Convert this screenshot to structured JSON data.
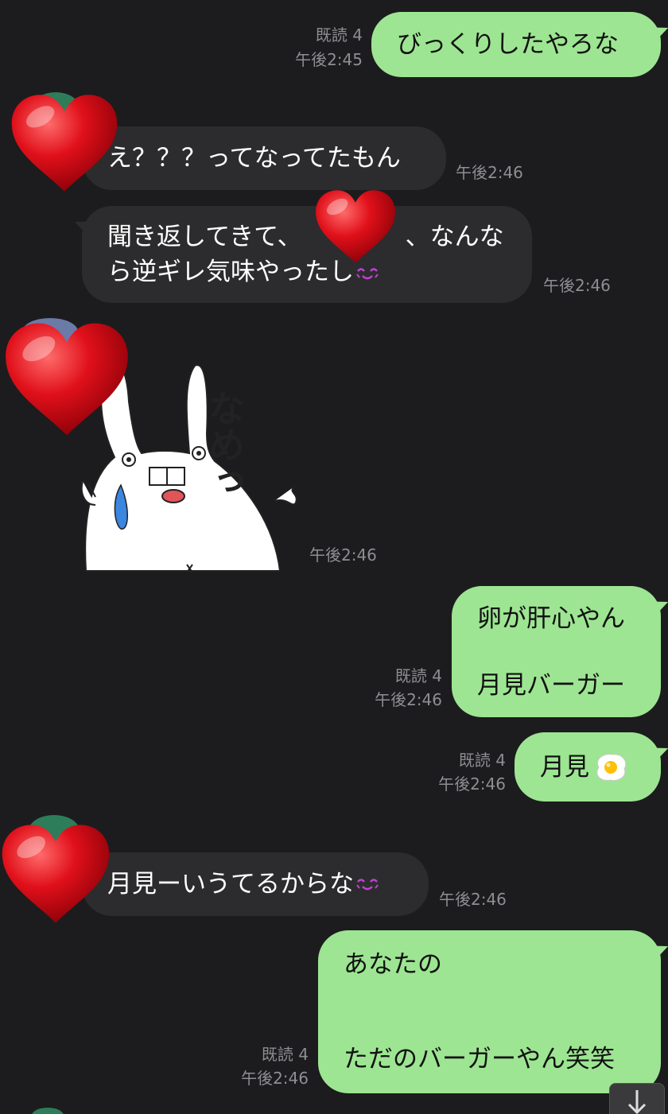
{
  "messages": [
    {
      "text": "びっくりしたやろな",
      "read": "既読 4",
      "time": "午後2:45"
    },
    {
      "text": "え？？？ってなってたもん",
      "time": "午後2:46"
    },
    {
      "line1": "聞き返してきて、",
      "line1b": "、なんな",
      "line2": "ら逆ギレ気味やったし",
      "time": "午後2:46"
    },
    {
      "sticker_text": "なめっ",
      "time": "午後2:46"
    },
    {
      "line1": "卵が肝心やん",
      "line2": "月見バーガー",
      "read": "既読 4",
      "time": "午後2:46"
    },
    {
      "text": "月見",
      "read": "既読 4",
      "time": "午後2:46"
    },
    {
      "text": "月見ーいうてるからな",
      "time": "午後2:46"
    },
    {
      "line1": "あなたの",
      "line2": "ただのバーガーやん笑笑",
      "read": "既読 4",
      "time": "午後2:46"
    }
  ],
  "icons": {
    "heart": "heart-sticker-icon",
    "scroll": "arrow-down-icon",
    "egg": "fried-egg-emoji",
    "blush": "blush-face-emoji"
  },
  "colors": {
    "background": "#1c1c1e",
    "outgoing_bubble": "#9de592",
    "incoming_bubble": "#2c2c2e",
    "meta_text": "#8e8e93",
    "heart": "#e0101a"
  }
}
